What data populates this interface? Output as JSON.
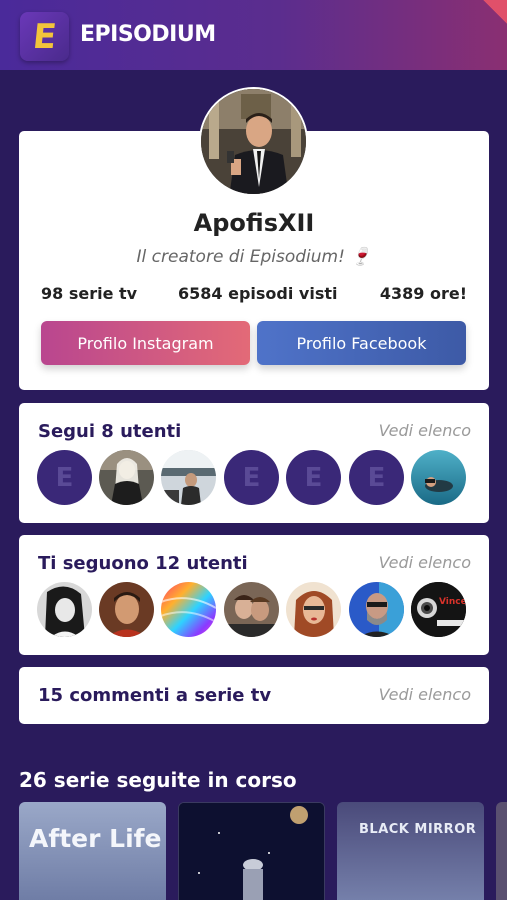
{
  "app": {
    "title": "EPISODIUM",
    "logo_letter": "E"
  },
  "profile": {
    "username": "ApofisXII",
    "tagline": "Il creatore di Episodium! 🍷",
    "stats": {
      "series": "98 serie tv",
      "episodes": "6584 episodi visti",
      "hours": "4389 ore!"
    },
    "buttons": {
      "instagram": "Profilo Instagram",
      "facebook": "Profilo Facebook"
    }
  },
  "follows": {
    "title": "Segui 8 utenti",
    "link": "Vedi elenco",
    "avatars": [
      "default-e",
      "photo",
      "photo",
      "default-e",
      "default-e",
      "default-e",
      "photo"
    ]
  },
  "followers": {
    "title": "Ti seguono 12 utenti",
    "link": "Vedi elenco",
    "avatars": [
      "photo",
      "photo",
      "photo",
      "photo",
      "photo",
      "photo",
      "photo"
    ],
    "avatar_text": "Vince Colle"
  },
  "comments": {
    "title": "15 commenti a serie tv",
    "link": "Vedi elenco"
  },
  "watching": {
    "title": "26 serie seguite in corso",
    "posters": [
      {
        "label": "After Life"
      },
      {
        "label": ""
      },
      {
        "label": "BLACK MIRROR"
      }
    ]
  },
  "colors": {
    "background": "#2a1b5c",
    "accent_yellow": "#f3c53b",
    "instagram_gradient": "#b9468f",
    "facebook_blue": "#4f73c9"
  }
}
